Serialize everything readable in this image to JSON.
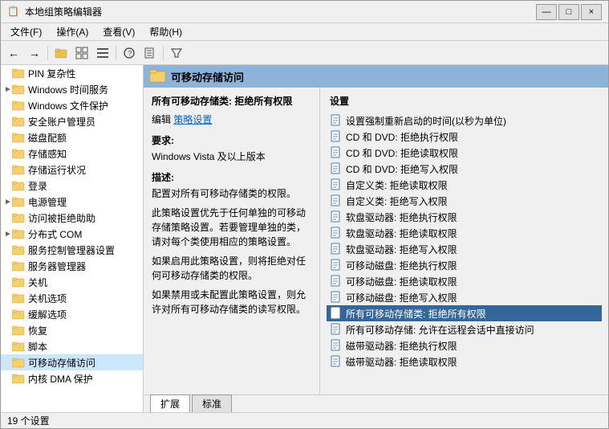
{
  "window": {
    "title": "本地组策略编辑器",
    "title_icon": "📋"
  },
  "title_buttons": {
    "minimize": "—",
    "maximize": "□",
    "close": "×"
  },
  "menu": {
    "items": [
      {
        "label": "文件(F)"
      },
      {
        "label": "操作(A)"
      },
      {
        "label": "查看(V)"
      },
      {
        "label": "帮助(H)"
      }
    ]
  },
  "content_header": {
    "title": "可移动存储访问",
    "icon": "📁"
  },
  "policy": {
    "title": "所有可移动存储类: 拒绝所有权限",
    "edit_label": "编辑",
    "edit_link": "策略设置",
    "req_label": "要求:",
    "req_value": "Windows Vista 及以上版本",
    "desc_label": "描述:",
    "desc_text1": "配置对所有可移动存储类的权限。",
    "desc_text2": "此策略设置优先于任何单独的可移动存储策略设置。若要管理单独的类，请对每个类使用相应的策略设置。",
    "desc_text3": "如果启用此策略设置，则将拒绝对任何可移动存储类的权限。",
    "desc_text4": "如果禁用或未配置此策略设置，则允许对所有可移动存储类的读写权限。"
  },
  "settings": {
    "label": "设置",
    "items": [
      {
        "text": "设置强制重新启动的时间(以秒为单位)"
      },
      {
        "text": "CD 和 DVD: 拒绝执行权限"
      },
      {
        "text": "CD 和 DVD: 拒绝读取权限"
      },
      {
        "text": "CD 和 DVD: 拒绝写入权限"
      },
      {
        "text": "自定义类: 拒绝读取权限"
      },
      {
        "text": "自定义类: 拒绝写入权限"
      },
      {
        "text": "软盘驱动器: 拒绝执行权限"
      },
      {
        "text": "软盘驱动器: 拒绝读取权限"
      },
      {
        "text": "软盘驱动器: 拒绝写入权限"
      },
      {
        "text": "可移动磁盘: 拒绝执行权限"
      },
      {
        "text": "可移动磁盘: 拒绝读取权限"
      },
      {
        "text": "可移动磁盘: 拒绝写入权限"
      },
      {
        "text": "所有可移动存储类: 拒绝所有权限",
        "selected": true
      },
      {
        "text": "所有可移动存储: 允许在远程会话中直接访问"
      },
      {
        "text": "磁带驱动器: 拒绝执行权限"
      },
      {
        "text": "磁带驱动器: 拒绝读取权限"
      }
    ]
  },
  "tabs": [
    {
      "label": "扩展",
      "active": true
    },
    {
      "label": "标准"
    }
  ],
  "status": {
    "text": "19 个设置"
  },
  "sidebar": {
    "items": [
      {
        "label": "PIN 复杂性",
        "indent": 0,
        "expandable": false
      },
      {
        "label": "Windows 时间服务",
        "indent": 0,
        "expandable": true
      },
      {
        "label": "Windows 文件保护",
        "indent": 0,
        "expandable": false
      },
      {
        "label": "安全账户管理员",
        "indent": 0,
        "expandable": false
      },
      {
        "label": "磁盘配额",
        "indent": 0,
        "expandable": false
      },
      {
        "label": "存储感知",
        "indent": 0,
        "expandable": false
      },
      {
        "label": "存储运行状况",
        "indent": 0,
        "expandable": false
      },
      {
        "label": "登录",
        "indent": 0,
        "expandable": false
      },
      {
        "label": "电源管理",
        "indent": 0,
        "expandable": true
      },
      {
        "label": "访问被拒绝助助",
        "indent": 0,
        "expandable": false
      },
      {
        "label": "分布式 COM",
        "indent": 0,
        "expandable": true
      },
      {
        "label": "服务控制管理器设置",
        "indent": 0,
        "expandable": false
      },
      {
        "label": "服务器管理器",
        "indent": 0,
        "expandable": false
      },
      {
        "label": "关机",
        "indent": 0,
        "expandable": false
      },
      {
        "label": "关机选项",
        "indent": 0,
        "expandable": false
      },
      {
        "label": "缓解选项",
        "indent": 0,
        "expandable": false
      },
      {
        "label": "恢复",
        "indent": 0,
        "expandable": false
      },
      {
        "label": "脚本",
        "indent": 0,
        "expandable": false
      },
      {
        "label": "可移动存储访问",
        "indent": 0,
        "expandable": false,
        "selected": true
      },
      {
        "label": "内核 DMA 保护",
        "indent": 0,
        "expandable": false
      }
    ]
  }
}
